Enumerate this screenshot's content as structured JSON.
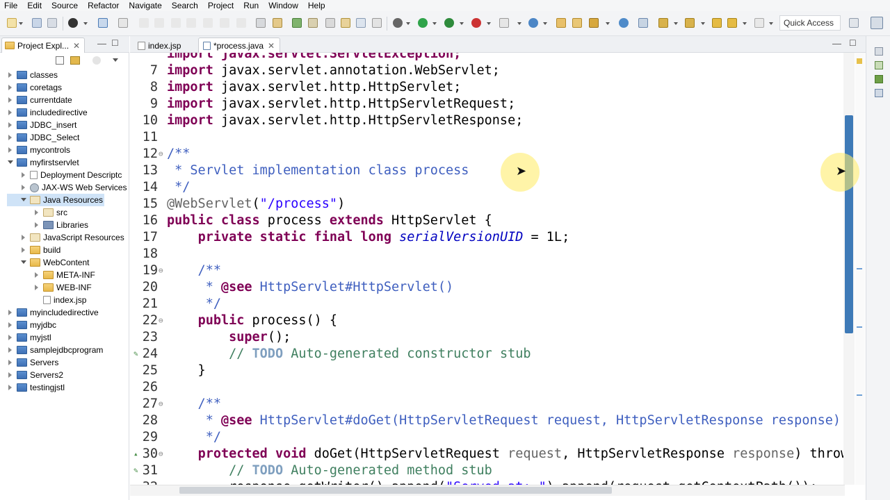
{
  "menu": [
    "File",
    "Edit",
    "Source",
    "Refactor",
    "Navigate",
    "Search",
    "Project",
    "Run",
    "Window",
    "Help"
  ],
  "toolbar": {
    "quick_access": "Quick Access"
  },
  "explorer": {
    "tab_label": "Project Expl...",
    "tree": [
      {
        "label": "classes",
        "depth": 0,
        "state": "closed",
        "icon": "project-icon"
      },
      {
        "label": "coretags",
        "depth": 0,
        "state": "closed",
        "icon": "project-icon"
      },
      {
        "label": "currentdate",
        "depth": 0,
        "state": "closed",
        "icon": "project-icon"
      },
      {
        "label": "includedirective",
        "depth": 0,
        "state": "closed",
        "icon": "project-icon"
      },
      {
        "label": "JDBC_insert",
        "depth": 0,
        "state": "closed",
        "icon": "project-icon"
      },
      {
        "label": "JDBC_Select",
        "depth": 0,
        "state": "closed",
        "icon": "project-icon"
      },
      {
        "label": "mycontrols",
        "depth": 0,
        "state": "closed",
        "icon": "project-icon"
      },
      {
        "label": "myfirstservlet",
        "depth": 0,
        "state": "open",
        "icon": "project-icon"
      },
      {
        "label": "Deployment Descriptc",
        "depth": 1,
        "state": "closed",
        "icon": "descriptor-icon"
      },
      {
        "label": "JAX-WS Web Services",
        "depth": 1,
        "state": "closed",
        "icon": "webservice-icon"
      },
      {
        "label": "Java Resources",
        "depth": 1,
        "state": "open",
        "icon": "java-resources-icon",
        "selected": true
      },
      {
        "label": "src",
        "depth": 2,
        "state": "closed",
        "icon": "source-folder-icon"
      },
      {
        "label": "Libraries",
        "depth": 2,
        "state": "closed",
        "icon": "library-icon"
      },
      {
        "label": "JavaScript Resources",
        "depth": 1,
        "state": "closed",
        "icon": "js-resources-icon"
      },
      {
        "label": "build",
        "depth": 1,
        "state": "closed",
        "icon": "folder-icon"
      },
      {
        "label": "WebContent",
        "depth": 1,
        "state": "open",
        "icon": "folder-icon"
      },
      {
        "label": "META-INF",
        "depth": 2,
        "state": "closed",
        "icon": "folder-icon"
      },
      {
        "label": "WEB-INF",
        "depth": 2,
        "state": "closed",
        "icon": "folder-icon"
      },
      {
        "label": "index.jsp",
        "depth": 2,
        "state": "none",
        "icon": "jsp-file-icon"
      },
      {
        "label": "myincludedirective",
        "depth": 0,
        "state": "closed",
        "icon": "project-icon"
      },
      {
        "label": "myjdbc",
        "depth": 0,
        "state": "closed",
        "icon": "project-icon"
      },
      {
        "label": "myjstl",
        "depth": 0,
        "state": "closed",
        "icon": "project-icon"
      },
      {
        "label": "samplejdbcprogram",
        "depth": 0,
        "state": "closed",
        "icon": "project-icon"
      },
      {
        "label": "Servers",
        "depth": 0,
        "state": "closed",
        "icon": "project-icon"
      },
      {
        "label": "Servers2",
        "depth": 0,
        "state": "closed",
        "icon": "project-icon"
      },
      {
        "label": "testingjstl",
        "depth": 0,
        "state": "closed",
        "icon": "project-icon"
      }
    ]
  },
  "editor": {
    "tabs": [
      {
        "label": "index.jsp",
        "active": false
      },
      {
        "label": "*process.java",
        "active": true
      }
    ],
    "lines": [
      {
        "n": "",
        "fold": "",
        "marker": "",
        "tokens": [
          {
            "t": "import javax.servlet.ServletException;",
            "c": "kw"
          }
        ]
      },
      {
        "n": "7",
        "fold": "",
        "marker": "",
        "tokens": [
          {
            "t": "import",
            "c": "kw"
          },
          {
            "t": " javax.servlet.annotation.WebServlet;",
            "c": ""
          }
        ]
      },
      {
        "n": "8",
        "fold": "",
        "marker": "",
        "tokens": [
          {
            "t": "import",
            "c": "kw"
          },
          {
            "t": " javax.servlet.http.HttpServlet;",
            "c": ""
          }
        ]
      },
      {
        "n": "9",
        "fold": "",
        "marker": "",
        "tokens": [
          {
            "t": "import",
            "c": "kw"
          },
          {
            "t": " javax.servlet.http.HttpServletRequest;",
            "c": ""
          }
        ]
      },
      {
        "n": "10",
        "fold": "",
        "marker": "",
        "tokens": [
          {
            "t": "import",
            "c": "kw"
          },
          {
            "t": " javax.servlet.http.HttpServletResponse;",
            "c": ""
          }
        ]
      },
      {
        "n": "11",
        "fold": "",
        "marker": "",
        "tokens": []
      },
      {
        "n": "12",
        "fold": "⊖",
        "marker": "",
        "tokens": [
          {
            "t": "/**",
            "c": "cm"
          }
        ]
      },
      {
        "n": "13",
        "fold": "",
        "marker": "",
        "tokens": [
          {
            "t": " * Servlet implementation class process",
            "c": "cm"
          }
        ]
      },
      {
        "n": "14",
        "fold": "",
        "marker": "",
        "tokens": [
          {
            "t": " */",
            "c": "cm"
          }
        ]
      },
      {
        "n": "15",
        "fold": "",
        "marker": "",
        "tokens": [
          {
            "t": "@WebServlet",
            "c": "ann"
          },
          {
            "t": "(",
            "c": ""
          },
          {
            "t": "\"/process\"",
            "c": "str"
          },
          {
            "t": ")",
            "c": ""
          }
        ]
      },
      {
        "n": "16",
        "fold": "",
        "marker": "",
        "tokens": [
          {
            "t": "public class",
            "c": "kw"
          },
          {
            "t": " process ",
            "c": ""
          },
          {
            "t": "extends",
            "c": "kw"
          },
          {
            "t": " HttpServlet {",
            "c": ""
          }
        ]
      },
      {
        "n": "17",
        "fold": "",
        "marker": "",
        "tokens": [
          {
            "t": "    ",
            "c": ""
          },
          {
            "t": "private static final long",
            "c": "kw"
          },
          {
            "t": " ",
            "c": ""
          },
          {
            "t": "serialVersionUID",
            "c": "fld"
          },
          {
            "t": " = 1L;",
            "c": ""
          }
        ]
      },
      {
        "n": "18",
        "fold": "",
        "marker": "",
        "tokens": []
      },
      {
        "n": "19",
        "fold": "⊖",
        "marker": "",
        "tokens": [
          {
            "t": "    /**",
            "c": "cm"
          }
        ]
      },
      {
        "n": "20",
        "fold": "",
        "marker": "",
        "tokens": [
          {
            "t": "     * ",
            "c": "cm"
          },
          {
            "t": "@see",
            "c": "kw"
          },
          {
            "t": " HttpServlet#HttpServlet()",
            "c": "cm"
          }
        ]
      },
      {
        "n": "21",
        "fold": "",
        "marker": "",
        "tokens": [
          {
            "t": "     */",
            "c": "cm"
          }
        ]
      },
      {
        "n": "22",
        "fold": "⊖",
        "marker": "",
        "tokens": [
          {
            "t": "    ",
            "c": ""
          },
          {
            "t": "public",
            "c": "kw"
          },
          {
            "t": " process() {",
            "c": ""
          }
        ]
      },
      {
        "n": "23",
        "fold": "",
        "marker": "",
        "tokens": [
          {
            "t": "        ",
            "c": ""
          },
          {
            "t": "super",
            "c": "kw"
          },
          {
            "t": "();",
            "c": ""
          }
        ]
      },
      {
        "n": "24",
        "fold": "",
        "marker": "✎",
        "tokens": [
          {
            "t": "        // ",
            "c": "lc"
          },
          {
            "t": "TODO",
            "c": "todo"
          },
          {
            "t": " Auto-generated constructor stub",
            "c": "lc"
          }
        ]
      },
      {
        "n": "25",
        "fold": "",
        "marker": "",
        "tokens": [
          {
            "t": "    }",
            "c": ""
          }
        ]
      },
      {
        "n": "26",
        "fold": "",
        "marker": "",
        "tokens": []
      },
      {
        "n": "27",
        "fold": "⊖",
        "marker": "",
        "tokens": [
          {
            "t": "    /**",
            "c": "cm"
          }
        ]
      },
      {
        "n": "28",
        "fold": "",
        "marker": "",
        "tokens": [
          {
            "t": "     * ",
            "c": "cm"
          },
          {
            "t": "@see",
            "c": "kw"
          },
          {
            "t": " HttpServlet#doGet(HttpServletRequest request, HttpServletResponse response)",
            "c": "cm"
          }
        ]
      },
      {
        "n": "29",
        "fold": "",
        "marker": "",
        "tokens": [
          {
            "t": "     */",
            "c": "cm"
          }
        ]
      },
      {
        "n": "30",
        "fold": "⊖",
        "marker": "▴",
        "tokens": [
          {
            "t": "    ",
            "c": ""
          },
          {
            "t": "protected void",
            "c": "kw"
          },
          {
            "t": " doGet(HttpServletRequest ",
            "c": ""
          },
          {
            "t": "request",
            "c": "ann"
          },
          {
            "t": ", HttpServletResponse ",
            "c": ""
          },
          {
            "t": "response",
            "c": "ann"
          },
          {
            "t": ") throws ServletException, IOException {",
            "c": ""
          }
        ]
      },
      {
        "n": "31",
        "fold": "",
        "marker": "✎",
        "tokens": [
          {
            "t": "        // ",
            "c": "lc"
          },
          {
            "t": "TODO",
            "c": "todo"
          },
          {
            "t": " Auto-generated method stub",
            "c": "lc"
          }
        ]
      },
      {
        "n": "32",
        "fold": "",
        "marker": "",
        "tokens": [
          {
            "t": "        response.getWriter().append(",
            "c": ""
          },
          {
            "t": "\"Served at: \"",
            "c": "str"
          },
          {
            "t": ").append(request.getContextPath());",
            "c": ""
          }
        ]
      }
    ]
  },
  "colors": {
    "keyword": "#7f0055",
    "comment": "#3f5fbf",
    "string": "#2a00ff",
    "selection": "#cfe3f7",
    "scroll_thumb": "#3e7ab7"
  }
}
